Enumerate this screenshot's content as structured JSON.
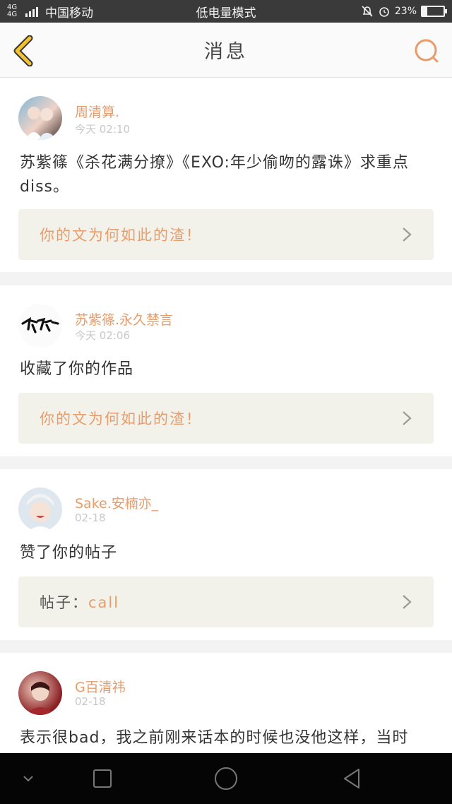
{
  "status_bar": {
    "network": "4G 4G",
    "carrier": "中国移动",
    "mode": "低电量模式",
    "battery": "23%",
    "battery_level": 0.23
  },
  "header": {
    "title": "消息"
  },
  "messages": [
    {
      "user": "周清算.",
      "time": "今天 02:10",
      "text": "苏紫篠《杀花满分撩》《EXO:年少偷吻的露诛》求重点diss。",
      "ref": "你的文为何如此的渣！",
      "ref_prefix": ""
    },
    {
      "user": "苏紫篠.永久禁言",
      "time": "今天 02:06",
      "text": "收藏了你的作品",
      "ref": "你的文为何如此的渣！",
      "ref_prefix": ""
    },
    {
      "user": "Sake.安楠亦_",
      "time": "02-18",
      "text": "赞了你的帖子",
      "ref": "call",
      "ref_prefix": "帖子："
    },
    {
      "user": "G百清祎",
      "time": "02-18",
      "text": "表示很bad，我之前刚来话本的时候也没他这样，当时",
      "ref": "",
      "ref_prefix": ""
    }
  ],
  "colors": {
    "accent": "#e89c6a",
    "back": "#f2c230",
    "ref_bg": "#f3f2ea"
  }
}
